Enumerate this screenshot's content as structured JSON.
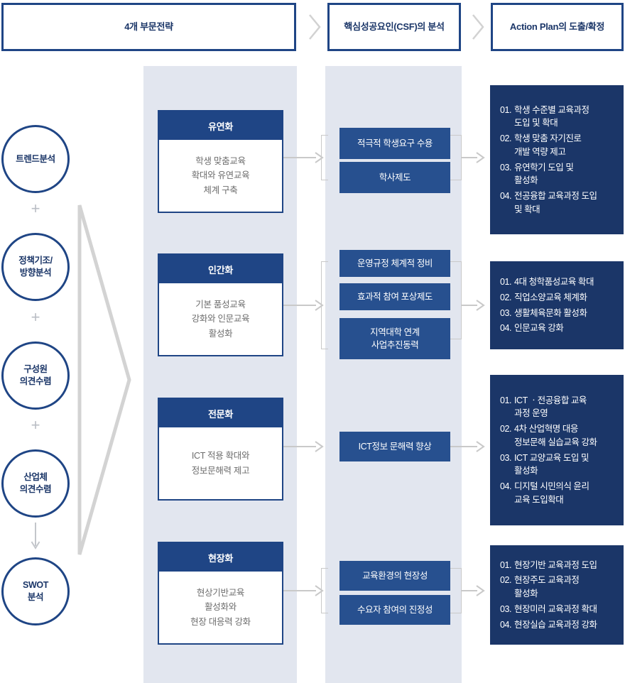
{
  "header": {
    "steps": [
      {
        "label": "4개 부문전략"
      },
      {
        "label": "핵심성공요인(CSF)의 분석"
      },
      {
        "label": "Action Plan의 도출/확정"
      }
    ],
    "separator": ">"
  },
  "inputs": {
    "circles": [
      {
        "label": "트렌드분석"
      },
      {
        "label": "정책기조/\n방향분석"
      },
      {
        "label": "구성원\n의견수렴"
      },
      {
        "label": "산업체\n의견수렴"
      },
      {
        "label": "SWOT\n분석"
      }
    ],
    "connector_plus": "+",
    "connector_arrow": "↓"
  },
  "strategies": [
    {
      "title": "유연화",
      "desc": "학생 맞춤교육\n확대와 유연교육\n체계 구축"
    },
    {
      "title": "인간화",
      "desc": "기본 품성교육\n강화와 인문교육\n활성화"
    },
    {
      "title": "전문화",
      "desc": "ICT 적용 확대와\n정보문해력 제고"
    },
    {
      "title": "현장화",
      "desc": "현상기반교육\n활성화와\n현장 대응력 강화"
    }
  ],
  "csf_groups": [
    {
      "items": [
        "적극적 학생요구 수용",
        "학사제도"
      ]
    },
    {
      "items": [
        "운영규정 체계적 정비",
        "효과적 참여 포상제도",
        "지역대학 연계\n사업추진동력"
      ]
    },
    {
      "items": [
        "ICT정보 문해력 향상"
      ]
    },
    {
      "items": [
        "교육환경의 현장성",
        "수요자 참여의 진정성"
      ]
    }
  ],
  "action_plans": [
    {
      "items": [
        {
          "num": "01.",
          "text": "학생 수준별 교육과정\n도입 및 확대"
        },
        {
          "num": "02.",
          "text": "학생 맞춤 자기진로\n개발 역량 제고"
        },
        {
          "num": "03.",
          "text": "유연학기 도입 및\n활성화"
        },
        {
          "num": "04.",
          "text": "전공융합 교육과정 도입\n및 확대"
        }
      ]
    },
    {
      "items": [
        {
          "num": "01.",
          "text": "4대 청학품성교육 확대"
        },
        {
          "num": "02.",
          "text": "직업소양교육 체계화"
        },
        {
          "num": "03.",
          "text": "생활체육문화 활성화"
        },
        {
          "num": "04.",
          "text": "인문교육 강화"
        }
      ]
    },
    {
      "items": [
        {
          "num": "01.",
          "text": "ICT ㆍ전공융합 교육\n과정 운영"
        },
        {
          "num": "02.",
          "text": "4차 산업혁명 대응\n정보문해 실습교육 강화"
        },
        {
          "num": "03.",
          "text": "ICT 교양교육 도입 및\n활성화"
        },
        {
          "num": "04.",
          "text": "디지털 시민의식 윤리\n교육 도입확대"
        }
      ]
    },
    {
      "items": [
        {
          "num": "01.",
          "text": "현장기반 교육과정 도입"
        },
        {
          "num": "02.",
          "text": "현장주도 교육과정\n활성화"
        },
        {
          "num": "03.",
          "text": "현장미러 교육과정 확대"
        },
        {
          "num": "04.",
          "text": "현장실습 교육과정 강화"
        }
      ]
    }
  ],
  "colors": {
    "brand_dark": "#1b3668",
    "brand": "#1f4585",
    "csf_blue": "#27508f",
    "band": "#e2e6ef",
    "connector": "#c9c9c9"
  }
}
